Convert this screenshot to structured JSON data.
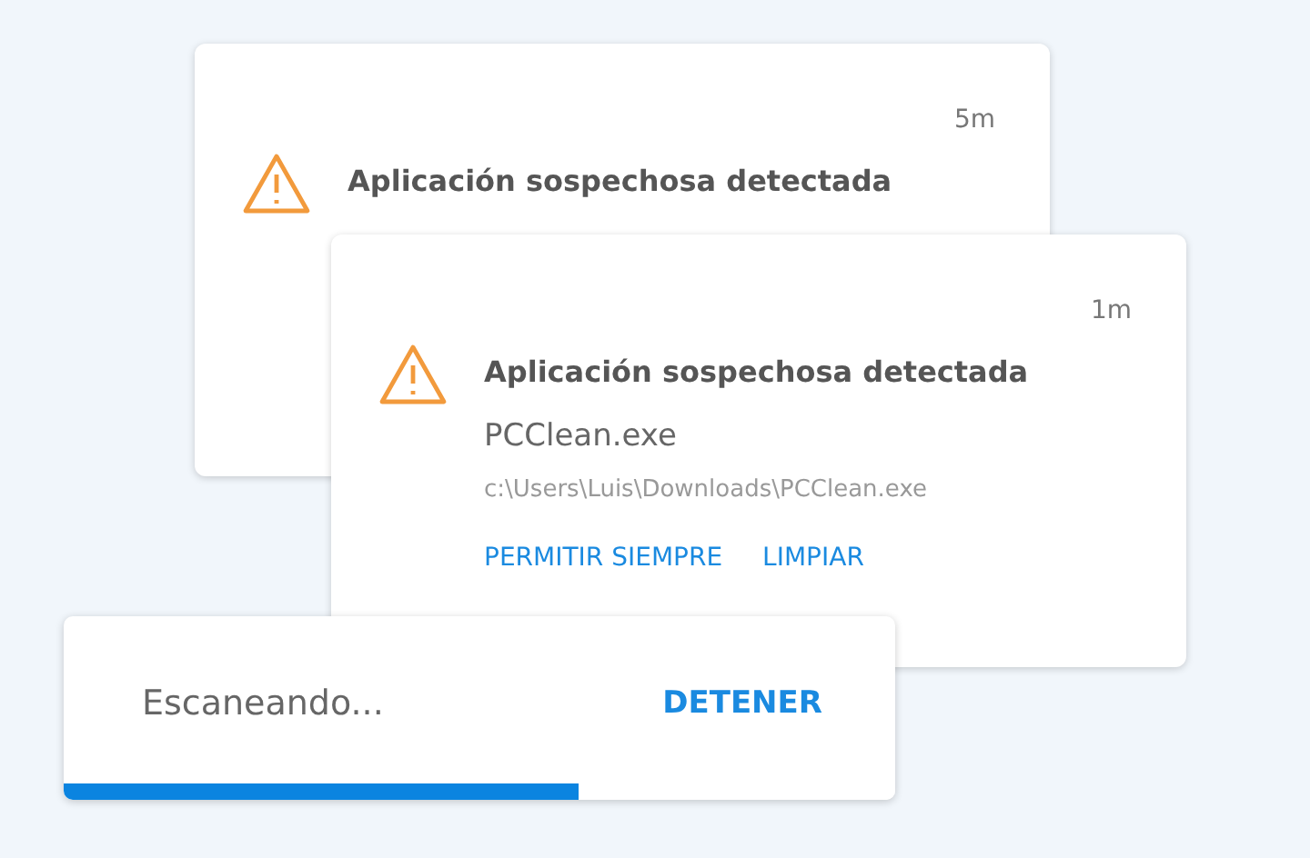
{
  "notifications": [
    {
      "time": "5m",
      "title": "Aplicación sospechosa detectada"
    },
    {
      "time": "1m",
      "title": "Aplicación sospechosa detectada",
      "file": "PCClean.exe",
      "path": "c:\\Users\\Luis\\Downloads\\PCClean.exe",
      "actions": [
        "PERMITIR SIEMPRE",
        "LIMPIAR"
      ]
    }
  ],
  "scan": {
    "status": "Escaneando...",
    "action": "DETENER",
    "level": 0.62
  }
}
